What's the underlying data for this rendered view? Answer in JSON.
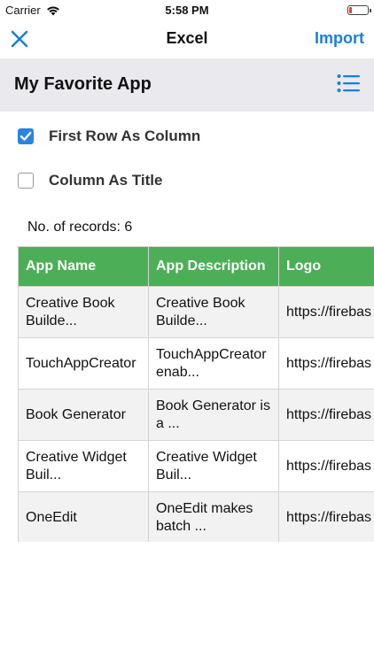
{
  "status_bar": {
    "carrier": "Carrier",
    "time": "5:58 PM",
    "battery_level": 0.15
  },
  "navbar": {
    "close_icon": "close-icon",
    "title": "Excel",
    "import_label": "Import"
  },
  "header": {
    "title": "My Favorite App",
    "list_icon": "list-icon"
  },
  "options": [
    {
      "label": "First Row As Column",
      "checked": true
    },
    {
      "label": "Column As Title",
      "checked": false
    }
  ],
  "records_label": "No. of records: 6",
  "table": {
    "columns": [
      "App Name",
      "App Description",
      "Logo"
    ],
    "rows": [
      [
        "Creative Book Builde...",
        "Creative Book Builde...",
        "https://firebas"
      ],
      [
        "TouchAppCreator",
        "TouchAppCreator enab...",
        "https://firebas"
      ],
      [
        "Book Generator",
        "Book Generator is a ...",
        "https://firebas"
      ],
      [
        "Creative Widget Buil...",
        "Creative Widget Buil...",
        "https://firebas"
      ],
      [
        "OneEdit",
        "OneEdit makes batch ...",
        "https://firebas"
      ]
    ]
  },
  "colors": {
    "accent": "#1a7fe0",
    "header_row": "#4caf57",
    "checkbox": "#2a84de",
    "battery": "#e2403a"
  }
}
